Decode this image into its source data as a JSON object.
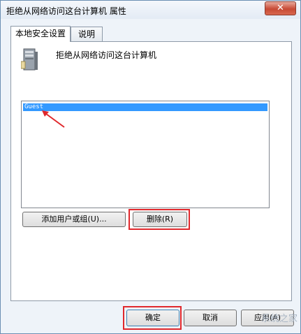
{
  "window": {
    "title": "拒绝从网络访问这台计算机 属性",
    "close_glyph": "✕"
  },
  "tabs": [
    {
      "label": "本地安全设置",
      "active": true
    },
    {
      "label": "说明",
      "active": false
    }
  ],
  "policy": {
    "title": "拒绝从网络访问这台计算机"
  },
  "list": {
    "items": [
      {
        "label": "Guest",
        "selected": true
      }
    ]
  },
  "buttons": {
    "add": "添加用户或组(U)...",
    "remove": "删除(R)"
  },
  "footer": {
    "ok": "确定",
    "cancel": "取消",
    "apply": "应用(A)"
  },
  "watermark": "系统之家",
  "colors": {
    "highlight": "#3399ff",
    "annotation": "#e0282c"
  }
}
